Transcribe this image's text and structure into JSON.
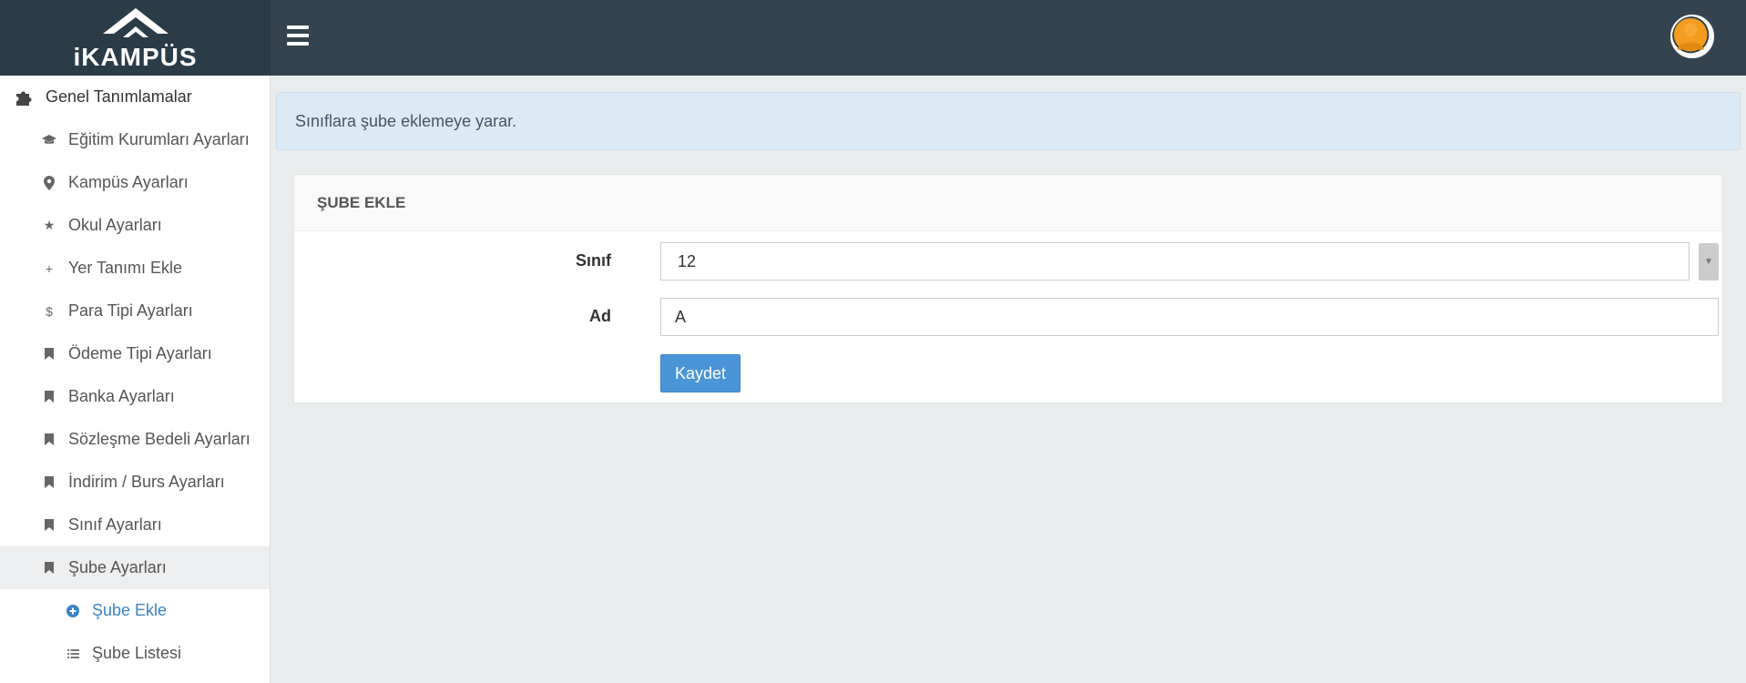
{
  "app": {
    "logo_text": "iKAMPÜS"
  },
  "header": {
    "menu_icon": "hamburger-menu-icon",
    "user_icon": "user-avatar-icon"
  },
  "sidebar": {
    "section_title": "Genel Tanımlamalar",
    "items": [
      {
        "label": "Eğitim Kurumları Ayarları",
        "icon": "graduation-cap-icon"
      },
      {
        "label": "Kampüs Ayarları",
        "icon": "map-marker-icon"
      },
      {
        "label": "Okul Ayarları",
        "icon": "star-icon"
      },
      {
        "label": "Yer Tanımı Ekle",
        "icon": "plus-icon"
      },
      {
        "label": "Para Tipi Ayarları",
        "icon": "dollar-icon"
      },
      {
        "label": "Ödeme Tipi Ayarları",
        "icon": "bookmark-icon"
      },
      {
        "label": "Banka Ayarları",
        "icon": "bookmark-icon"
      },
      {
        "label": "Sözleşme Bedeli Ayarları",
        "icon": "bookmark-icon"
      },
      {
        "label": "İndirim / Burs Ayarları",
        "icon": "bookmark-icon"
      },
      {
        "label": "Sınıf Ayarları",
        "icon": "bookmark-icon"
      },
      {
        "label": "Şube Ayarları",
        "icon": "bookmark-icon"
      }
    ],
    "subitems": [
      {
        "label": "Şube Ekle",
        "icon": "plus-circle-icon"
      },
      {
        "label": "Şube Listesi",
        "icon": "list-icon"
      }
    ]
  },
  "info": {
    "text": "Sınıflara şube eklemeye yarar."
  },
  "panel": {
    "title": "ŞUBE EKLE",
    "class_label": "Sınıf",
    "class_value": "12",
    "name_label": "Ad",
    "name_value": "A",
    "save_label": "Kaydet"
  },
  "colors": {
    "topbar": "#33434f",
    "logo_bg": "#2b3c49",
    "accent": "#3a83c4",
    "button": "#4a95d8",
    "info_bg": "#dceaf6"
  }
}
